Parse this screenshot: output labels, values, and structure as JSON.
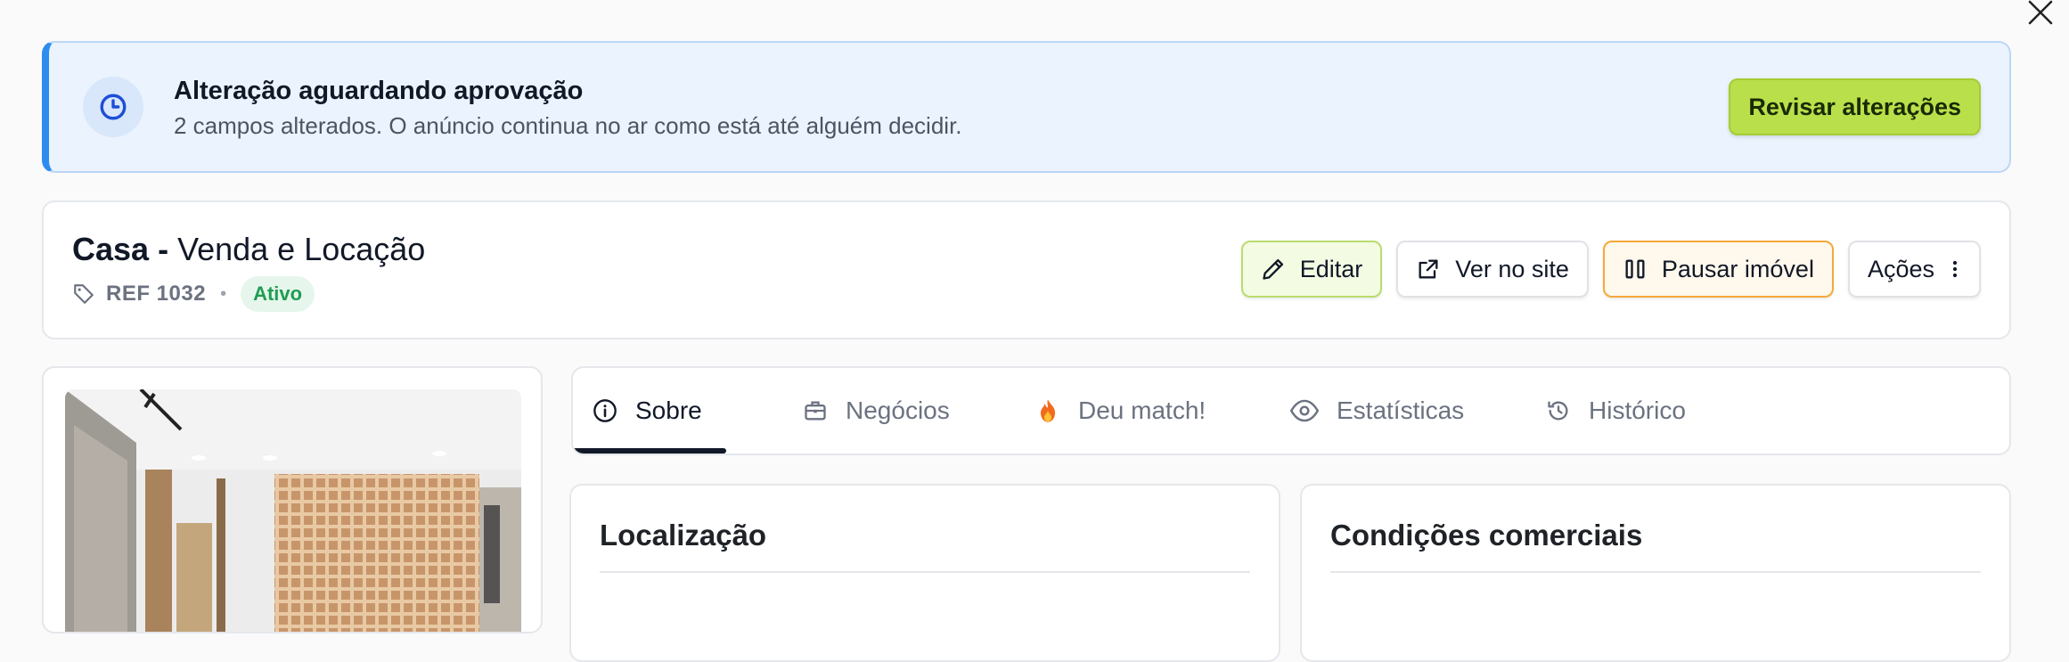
{
  "banner": {
    "title": "Alteração aguardando aprovação",
    "subtitle": "2 campos alterados. O anúncio continua no ar como está até alguém decidir.",
    "review_label": "Revisar alterações",
    "accent": "#2d8cf0",
    "button_color": "#b9e04a"
  },
  "property": {
    "kind": "Casa",
    "separator": " - ",
    "type": "Venda e Locação",
    "ref": "REF 1032",
    "status": "Ativo",
    "status_color": "#1f9d52"
  },
  "actions": {
    "edit": "Editar",
    "view_site": "Ver no site",
    "pause": "Pausar imóvel",
    "more": "Ações"
  },
  "tabs": [
    {
      "label": "Sobre",
      "icon": "info-icon",
      "active": true
    },
    {
      "label": "Negócios",
      "icon": "briefcase-icon",
      "active": false
    },
    {
      "label": "Deu match!",
      "icon": "fire-icon",
      "active": false
    },
    {
      "label": "Estatísticas",
      "icon": "eye-icon",
      "active": false
    },
    {
      "label": "Histórico",
      "icon": "history-icon",
      "active": false
    }
  ],
  "sections": {
    "location": "Localização",
    "commercial": "Condições comerciais"
  },
  "icons": {
    "close": "close-icon",
    "banner": "clock-icon",
    "tag": "tag-icon",
    "edit": "pencil-icon",
    "external": "external-link-icon",
    "pause": "pause-icon",
    "more": "more-vertical-icon"
  }
}
